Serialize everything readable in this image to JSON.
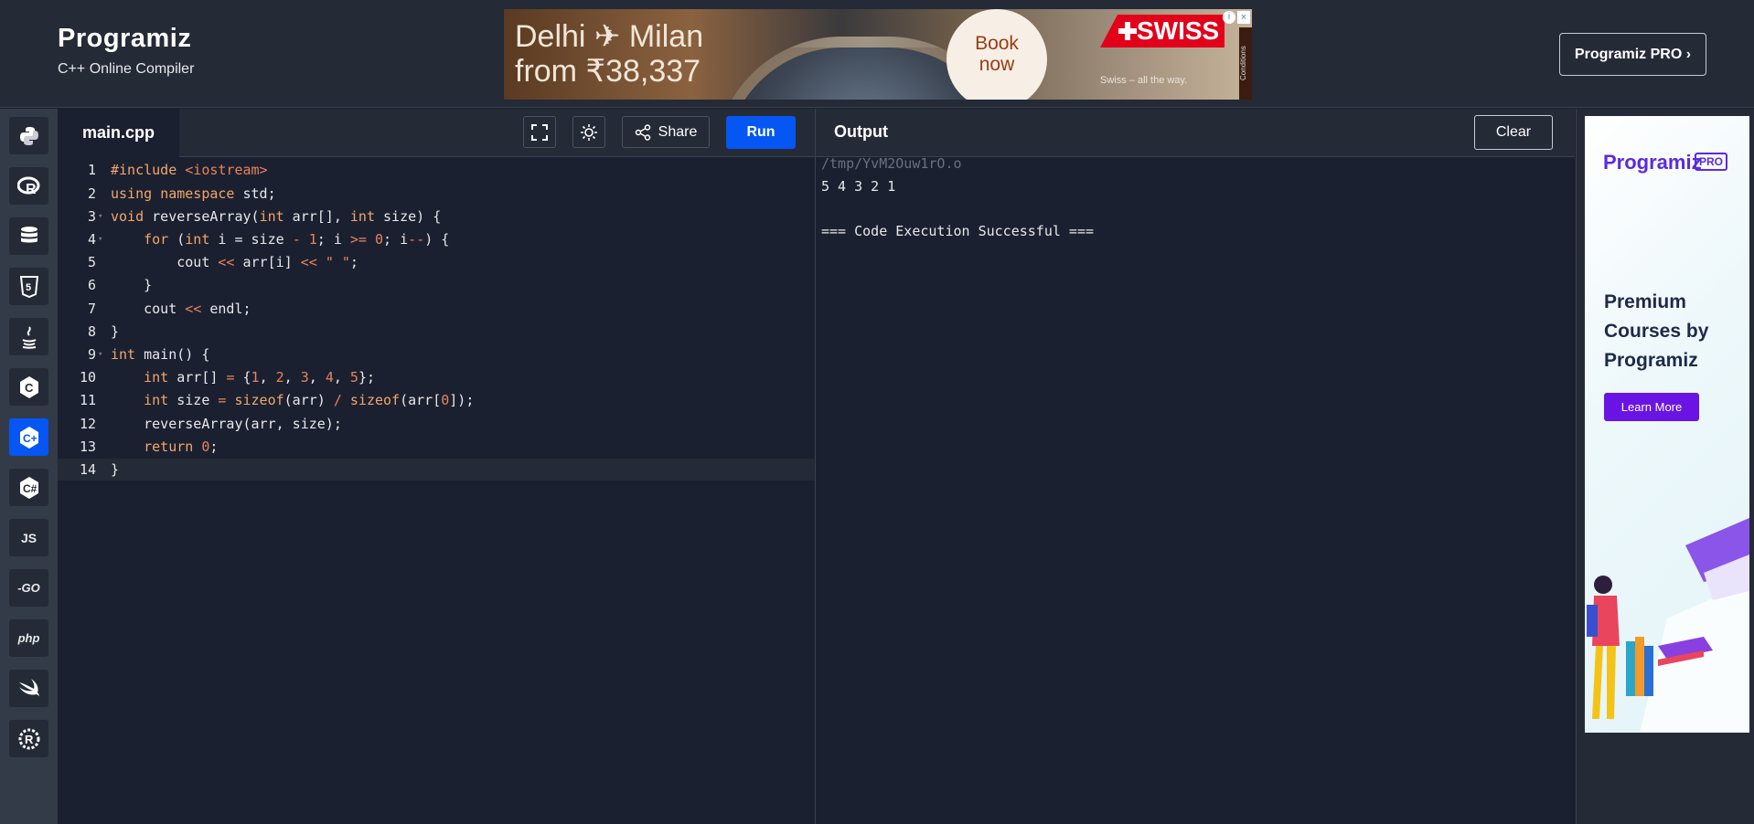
{
  "header": {
    "logo": "Programiz",
    "subtitle": "C++ Online Compiler",
    "pro_button": "Programiz PRO ›"
  },
  "ad": {
    "line1": "Delhi ✈ Milan",
    "line2": "from ₹38,337",
    "book_line1": "Book",
    "book_line2": "now",
    "brand": "SWISS",
    "small": "Swiss – all the way.",
    "conditions": "Conditions"
  },
  "sidebar": {
    "items": [
      {
        "name": "python",
        "glyph": "Py"
      },
      {
        "name": "r",
        "glyph": "R"
      },
      {
        "name": "sql",
        "glyph": "DB"
      },
      {
        "name": "html",
        "glyph": "5"
      },
      {
        "name": "java",
        "glyph": "☕"
      },
      {
        "name": "c",
        "glyph": "C"
      },
      {
        "name": "cpp",
        "glyph": "C+"
      },
      {
        "name": "csharp",
        "glyph": "C#"
      },
      {
        "name": "js",
        "glyph": "JS"
      },
      {
        "name": "go",
        "glyph": "GO"
      },
      {
        "name": "php",
        "glyph": "php"
      },
      {
        "name": "swift",
        "glyph": "✈"
      },
      {
        "name": "rust",
        "glyph": "R"
      }
    ],
    "active": "cpp"
  },
  "editor": {
    "filename": "main.cpp",
    "share_label": "Share",
    "run_label": "Run",
    "lines": [
      {
        "n": "1",
        "html": "<span class='kw'>#include</span> <span class='str'>&lt;iostream&gt;</span>"
      },
      {
        "n": "2",
        "html": "<span class='kw'>using</span> <span class='kw'>namespace</span> std;"
      },
      {
        "n": "3",
        "html": "<span class='kw'>void</span> reverseArray(<span class='kw'>int</span> arr[], <span class='kw'>int</span> size) {",
        "fold": true
      },
      {
        "n": "4",
        "html": "    <span class='kw'>for</span> (<span class='kw'>int</span> i = size <span class='str'>-</span> <span class='num'>1</span>; i <span class='str'>&gt;=</span> <span class='num'>0</span>; i<span class='str'>--</span>) {",
        "fold": true
      },
      {
        "n": "5",
        "html": "        cout <span class='str'>&lt;&lt;</span> arr[i] <span class='str'>&lt;&lt;</span> <span class='str'>\" \"</span>;"
      },
      {
        "n": "6",
        "html": "    }"
      },
      {
        "n": "7",
        "html": "    cout <span class='str'>&lt;&lt;</span> endl;"
      },
      {
        "n": "8",
        "html": "}"
      },
      {
        "n": "9",
        "html": "<span class='kw'>int</span> main() {",
        "fold": true
      },
      {
        "n": "10",
        "html": "    <span class='kw'>int</span> arr[] <span class='str'>=</span> {<span class='num'>1</span>, <span class='num'>2</span>, <span class='num'>3</span>, <span class='num'>4</span>, <span class='num'>5</span>};"
      },
      {
        "n": "11",
        "html": "    <span class='kw'>int</span> size <span class='str'>=</span> <span class='kw'>sizeof</span>(arr) <span class='str'>/</span> <span class='kw'>sizeof</span>(arr[<span class='num'>0</span>]);"
      },
      {
        "n": "12",
        "html": "    reverseArray(arr, size);"
      },
      {
        "n": "13",
        "html": "    <span class='kw'>return</span> <span class='num'>0</span>;"
      },
      {
        "n": "14",
        "html": "}",
        "current": true
      }
    ]
  },
  "output": {
    "title": "Output",
    "clear_label": "Clear",
    "path": "/tmp/YvM2Ouw1rO.o",
    "result": "5 4 3 2 1",
    "status": "=== Code Execution Successful ==="
  },
  "promo": {
    "logo": "Programiz",
    "badge": "PRO",
    "heading": "Premium Courses by Programiz",
    "button": "Learn More"
  }
}
